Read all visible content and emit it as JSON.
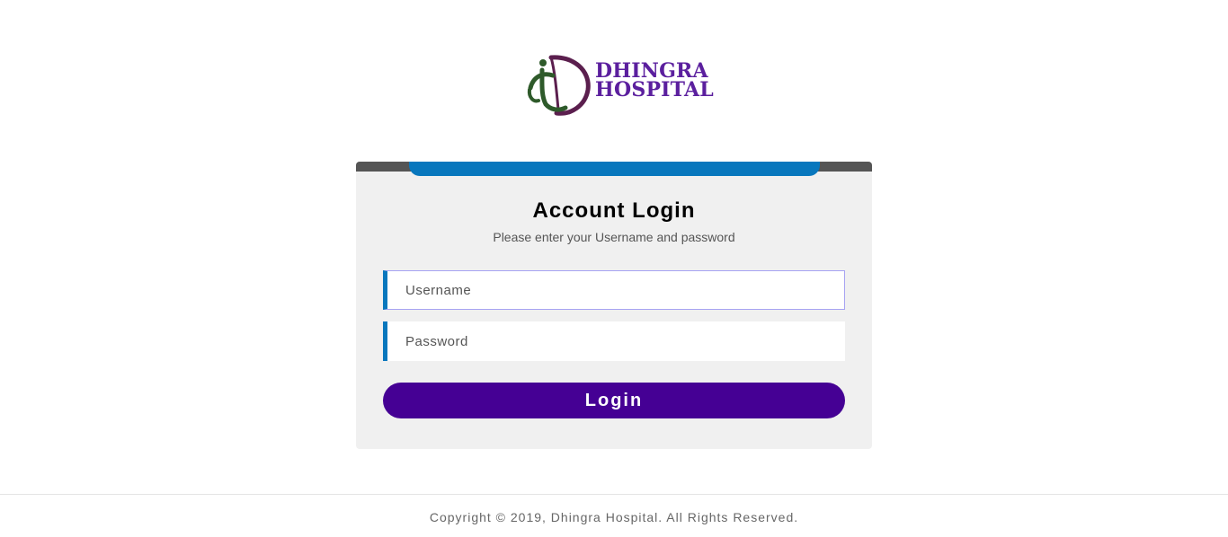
{
  "brand": {
    "line1": "DHINGRA",
    "line2": "HOSPITAL",
    "text_color": "#5b1f9e",
    "mark_colors": [
      "#2e5a2a",
      "#5b1f4e"
    ],
    "logo_icon": "dhingra-hospital-emblem"
  },
  "login": {
    "title": "Account Login",
    "subtitle": "Please enter your Username and password",
    "username_placeholder": "Username",
    "password_placeholder": "Password",
    "button_label": "Login",
    "accent_color": "#0877bd",
    "button_color": "#450094",
    "topbar_color": "#555555"
  },
  "footer": {
    "copyright": "Copyright © 2019, Dhingra Hospital. All Rights Reserved."
  }
}
